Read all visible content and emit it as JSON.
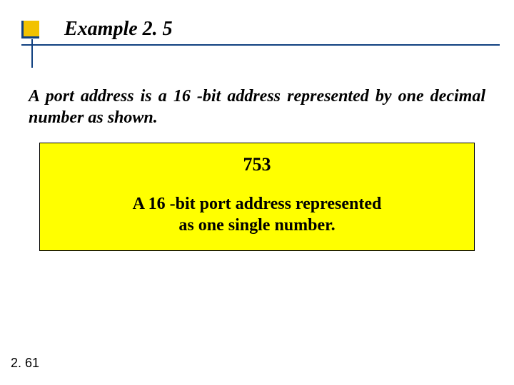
{
  "title": "Example 2. 5",
  "body": "A port address is a 16 -bit address represented by one decimal number as shown.",
  "box": {
    "value": "753",
    "caption_line1": "A 16 -bit port address represented",
    "caption_line2": "as one single number."
  },
  "page_number": "2. 61"
}
